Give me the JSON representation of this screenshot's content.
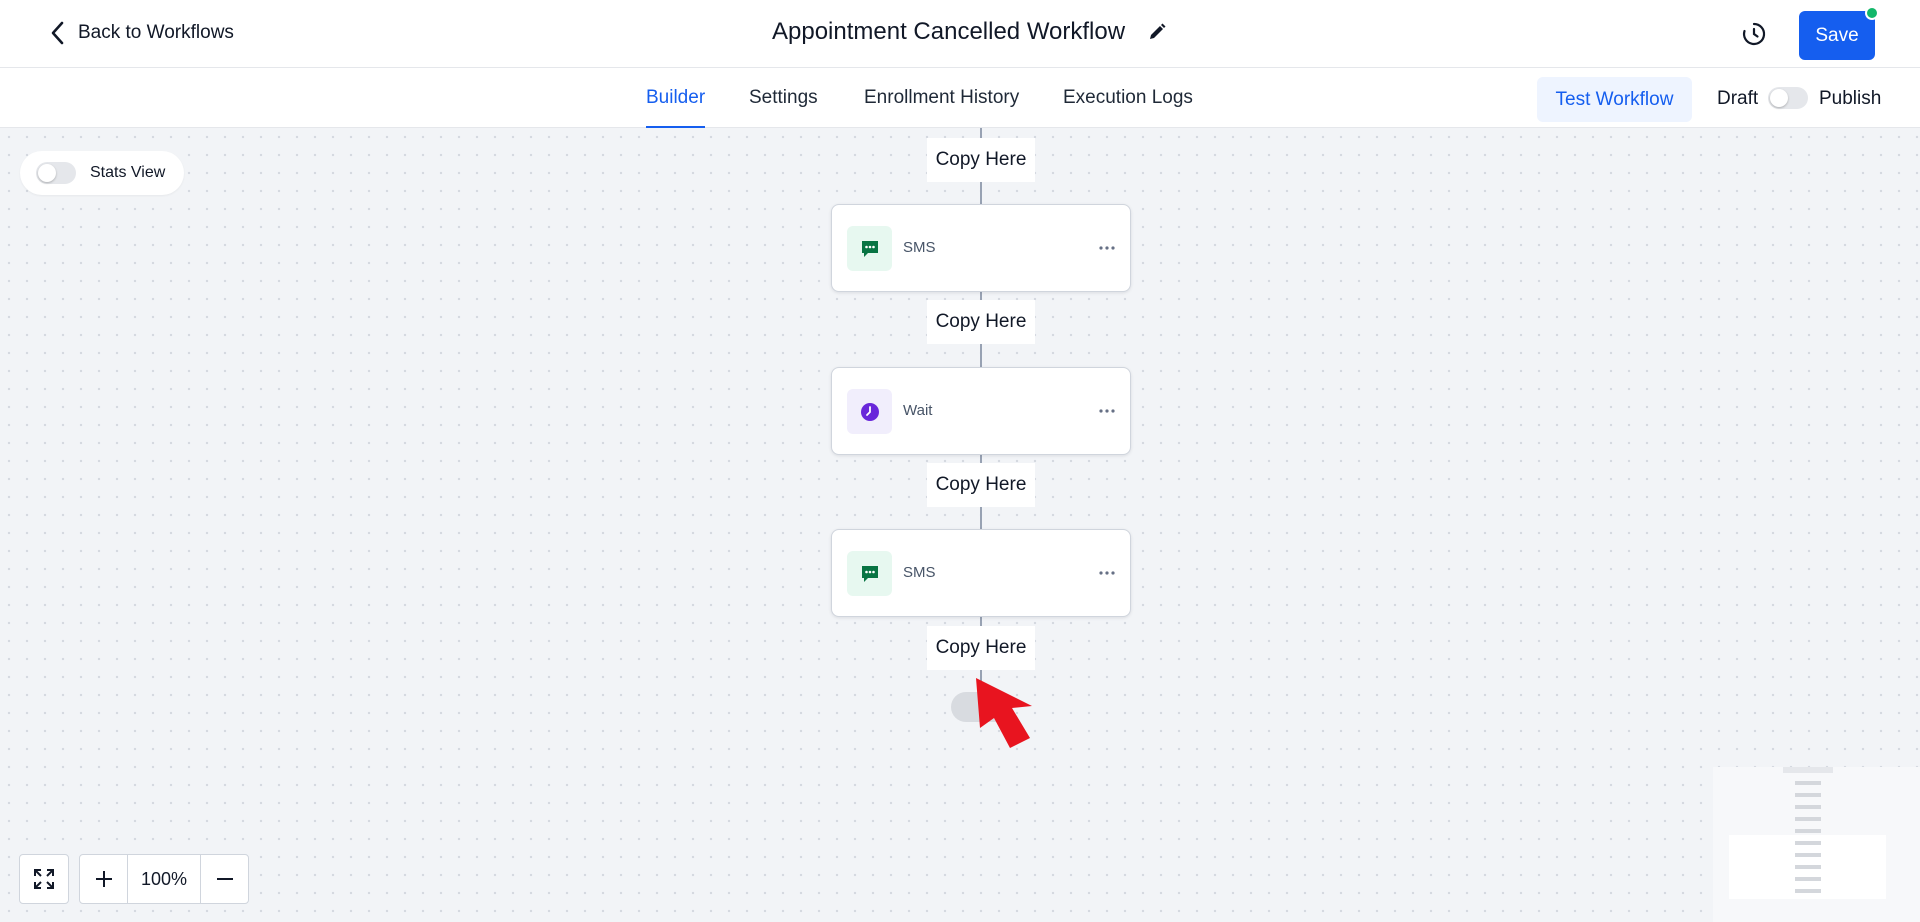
{
  "header": {
    "back_label": "Back to Workflows",
    "title": "Appointment Cancelled Workflow",
    "save_label": "Save"
  },
  "tabs": [
    {
      "label": "Builder",
      "active": true
    },
    {
      "label": "Settings",
      "active": false
    },
    {
      "label": "Enrollment History",
      "active": false
    },
    {
      "label": "Execution Logs",
      "active": false
    }
  ],
  "toolbar": {
    "test_label": "Test Workflow",
    "draft_label": "Draft",
    "publish_label": "Publish",
    "published": false
  },
  "canvas": {
    "stats_view_label": "Stats View",
    "stats_view_on": false,
    "copy_here_label": "Copy Here",
    "nodes": [
      {
        "type": "sms",
        "label": "SMS",
        "icon": "chat-icon"
      },
      {
        "type": "wait",
        "label": "Wait",
        "icon": "clock-icon"
      },
      {
        "type": "sms",
        "label": "SMS",
        "icon": "chat-icon"
      }
    ]
  },
  "zoom": {
    "level": "100%"
  },
  "colors": {
    "primary": "#155eef",
    "sms_icon": "#087443",
    "wait_icon": "#6927da",
    "status_dot": "#12b76a",
    "arrow": "#e8141f"
  }
}
